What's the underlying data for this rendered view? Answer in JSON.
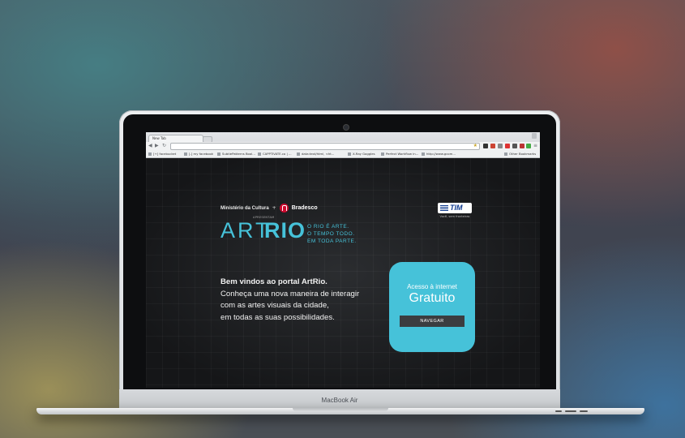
{
  "device": {
    "label": "MacBook Air"
  },
  "browser": {
    "tab_title": "New Tab",
    "address_value": "",
    "bookmarks": [
      "[+] facebucket",
      "[-] my facebook",
      "SubtlePatterns Bool...",
      "CAPPTIVATE.co | ...",
      "data:text/html, <ht...",
      "X-Ray Goggles",
      "Perfect Workflow in...",
      "http://www.gcom..."
    ],
    "other_bookmarks": "Other Bookmarks"
  },
  "site": {
    "sponsor_ministry": "Ministério da Cultura",
    "sponsor_plus": "+",
    "sponsor_bank": "Bradesco",
    "presents": "APRESENTAM",
    "logo_art": "ART",
    "logo_rio": "RIO",
    "tagline": [
      "O RIO É ARTE.",
      "O TEMPO TODO.",
      "EM TODA PARTE."
    ],
    "partner": {
      "logo": "TIM",
      "slogan": "Você, sem fronteiras"
    },
    "welcome": [
      "Bem vindos ao portal ArtRio.",
      "Conheça uma nova maneira de interagir",
      "com as artes visuais da cidade,",
      "em todas as suas possibilidades."
    ],
    "card": {
      "subtitle": "Acesso à internet",
      "title": "Gratuito",
      "button": "NAVEGAR"
    }
  },
  "colors": {
    "accent": "#46c2d9",
    "bradesco_red": "#cc0a2f",
    "tim_blue": "#0e3a8f"
  }
}
